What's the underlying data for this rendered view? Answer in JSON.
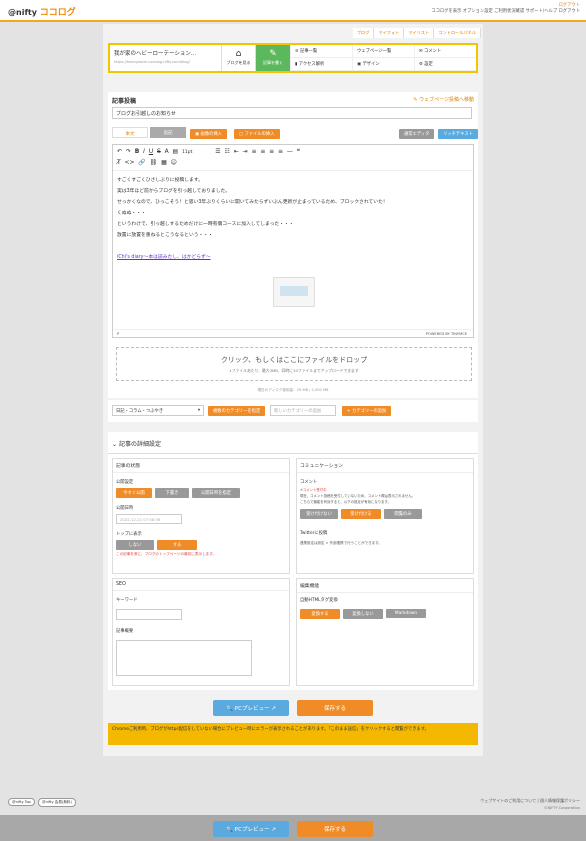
{
  "header": {
    "logo_prefix": "@nifty",
    "logo_main": "ココログ",
    "links_line1": "ログアウト",
    "links_line2": "ココログを表示 オプション設定 ご利用状況確認 サポート/ヘルプ ログアウト"
  },
  "tabs": [
    "ブログ",
    "マイフォト",
    "マイリスト",
    "コントロールパネル"
  ],
  "nav": {
    "blog_title": "我が家のヘビーローテーション...",
    "blog_url": "https://heavyroom.cocolog-nifty.com/blog/",
    "view_label": "ブログを見る",
    "write_label": "記事を書く",
    "items": [
      "記事一覧",
      "ウェブページ一覧",
      "コメント",
      "アクセス解析",
      "デザイン",
      "設定"
    ]
  },
  "post": {
    "section_title": "記事投稿",
    "webpage_link": "ウェブページ投稿へ移動",
    "title_value": "ブログお引越しのお知らせ",
    "tab_body": "本文",
    "tab_more": "追記",
    "insert_image": "画像の挿入",
    "insert_file": "ファイルの挿入",
    "normal_editor": "通常エディタ",
    "rich_text": "リッチテキスト",
    "font_size": "11pt",
    "lines": [
      "すごくすごくひさしぶりに投稿します。",
      "実は3年ほど前からブログを引っ越しておりました。",
      "せっかくなので、ひっこそう！と思い3年ぶりくらいに開いてみたらずいぶん更新が止まっているため、ブロックされていた！",
      "くぬぬ・・・",
      "というわけで、引っ越しするためだけに一時有償コースに加入してしまった・・・",
      "放置に放置を重ねるとこうなるという・・・",
      "",
      "iChi's diary〜本は読みたし、はかどらず〜"
    ],
    "powered": "POWERED BY TINYMCE",
    "path": "P"
  },
  "upload": {
    "main": "クリック、もしくはここにファイルをドロップ",
    "sub": "1ファイルあたり、最大3MB、同時に10ファイルまでアップロードできます",
    "disk": "現在のディスク使用量：29 MB / 2,000 MB"
  },
  "category": {
    "selected": "日記・コラム・つぶやき",
    "choose": "複数のカテゴリーを指定",
    "new_placeholder": "新しいカテゴリーの追加",
    "add": "カテゴリーの追加"
  },
  "details": {
    "title": "記事の詳細設定",
    "status": {
      "title": "記事の状態",
      "publish_label": "公開設定",
      "opt1": "今すぐ公開",
      "opt2": "下書き",
      "opt3": "公開日時を指定",
      "date_label": "公開日時",
      "date_value": "2022-12-21 07:58:36",
      "top_label": "トップに表示",
      "top_no": "しない",
      "top_yes": "する",
      "top_note": "この記事を常に、ブログのトップページの最初に表示します。"
    },
    "comm": {
      "title": "コミュニケーション",
      "comment_label": "コメント",
      "warn": "※コメント受付中",
      "warn2": "現在、コメント投稿を受付していないため、コメント欄は表示されません。",
      "warn3": "こちらで機能を有効すると、以下の設定が有効になります。",
      "c1": "受け付けない",
      "c2": "受け付ける",
      "c3": "閲覧のみ",
      "twitter_label": "Twitterに投稿",
      "twitter_note": "連携設定は設定 > 外部連携で行うことができます。"
    },
    "seo": {
      "title": "SEO",
      "keyword": "キーワード",
      "summary": "記事概要"
    },
    "edit": {
      "title": "編集機能",
      "auto_html": "自動HTMLタグ変換",
      "e1": "変換する",
      "e2": "変換しない",
      "e3": "Markdown"
    }
  },
  "actions": {
    "preview": "PCプレビュー",
    "save": "保存する"
  },
  "notice": "Chromeご利用時、ブログがhttps配信をしていない場合にプレビュー時にエラーが表示されることがあります。「このまま送信」をクリックすると閲覧ができます。",
  "footer": {
    "badge1": "@nifty Top",
    "badge2": "@nifty 会員(無料)",
    "links": "ウェブサイトのご利用について | 個人情報保護ポリシー",
    "copyright": "©NIFTY Corporation"
  }
}
